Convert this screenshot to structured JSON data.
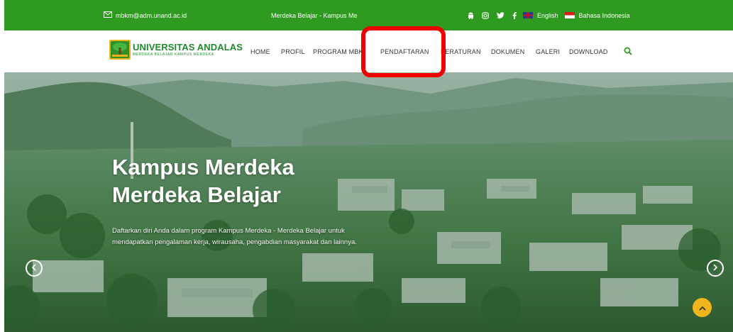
{
  "topbar": {
    "email": "mbkm@adm.unand.ac.id",
    "tagline": "Merdeka Belajar - Kampus Me",
    "social_icons": [
      "android-icon",
      "instagram-icon",
      "twitter-icon",
      "facebook-icon"
    ],
    "languages": [
      {
        "label": "English",
        "flag": "uk-flag-icon"
      },
      {
        "label": "Bahasa Indonesia",
        "flag": "indonesia-flag-icon"
      }
    ],
    "bg_color": "#2e9a1f"
  },
  "logo": {
    "name": "UNIVERSITAS ANDALAS",
    "subtitle": "MERDEKA BELAJAR KAMPUS MERDEKA"
  },
  "nav": {
    "items": [
      "HOME",
      "PROFIL",
      "PROGRAM MBK",
      "PENDAFTARAN",
      "PERATURAN",
      "DOKUMEN",
      "GALERI",
      "DOWNLOAD"
    ],
    "highlighted_item": "PENDAFTARAN",
    "highlight_color": "#f00000"
  },
  "hero": {
    "title_line1": "Kampus Merdeka",
    "title_line2": "Merdeka Belajar",
    "description": "Daftarkan diri Anda dalam program Kampus Merdeka - Merdeka Belajar untuk mendapatkan pengalaman kerja, wirausaha, pengabdian masyarakat dan lainnya."
  },
  "colors": {
    "brand_green": "#1f8a2b",
    "scroll_top": "#f0b51c"
  }
}
